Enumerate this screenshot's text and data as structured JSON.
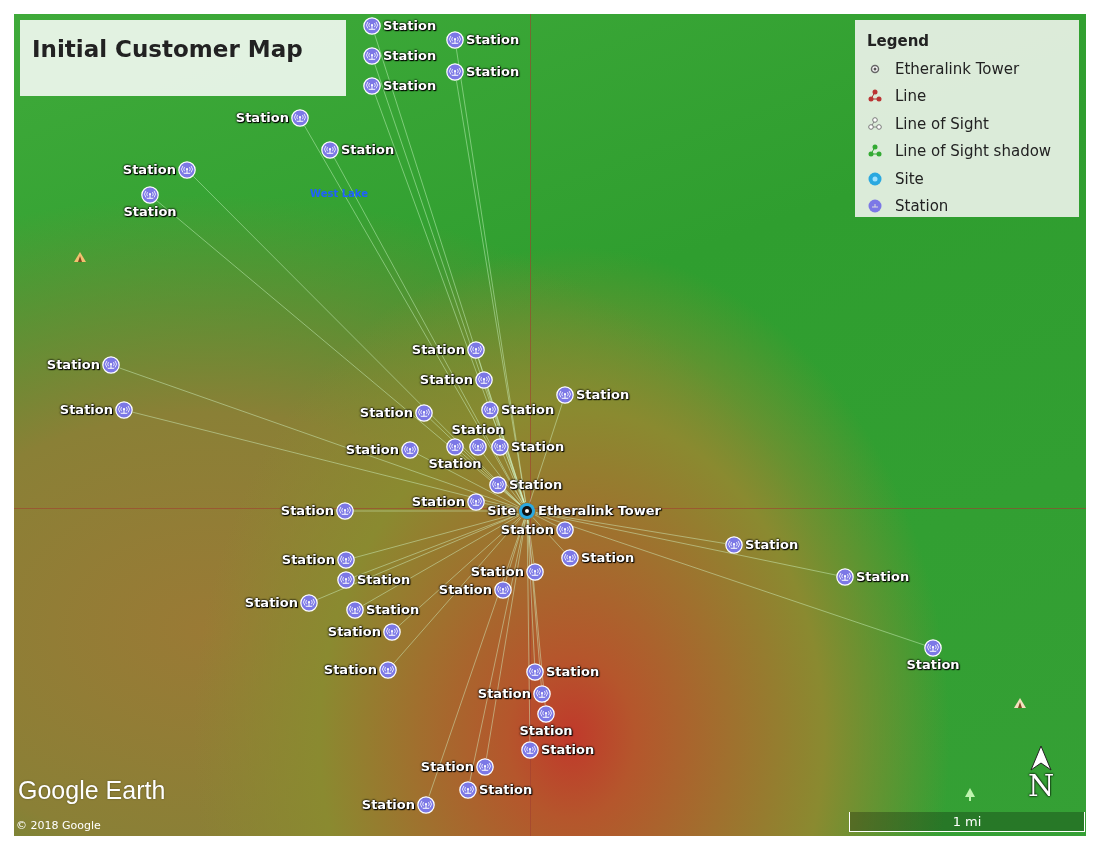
{
  "title": "Initial Customer Map",
  "legend": {
    "title": "Legend",
    "items": [
      {
        "label": "Etheralink Tower",
        "kind": "tower"
      },
      {
        "label": "Line",
        "kind": "line"
      },
      {
        "label": "Line of Sight",
        "kind": "los"
      },
      {
        "label": "Line of Sight shadow",
        "kind": "shadow"
      },
      {
        "label": "Site",
        "kind": "site"
      },
      {
        "label": "Station",
        "kind": "station"
      }
    ]
  },
  "map": {
    "place_label": "West Lake",
    "site_label": "Site",
    "tower_label": "Etheralink Tower",
    "stations": [
      {
        "label": "Station"
      },
      {
        "label": "Station"
      },
      {
        "label": "Station"
      },
      {
        "label": "Station"
      },
      {
        "label": "Station"
      },
      {
        "label": "Station"
      },
      {
        "label": "Station"
      },
      {
        "label": "Station"
      },
      {
        "label": "Station"
      },
      {
        "label": "Station"
      },
      {
        "label": "Station"
      },
      {
        "label": "Station"
      },
      {
        "label": "Station"
      },
      {
        "label": "Station"
      },
      {
        "label": "Station"
      },
      {
        "label": "Station"
      },
      {
        "label": "Station"
      },
      {
        "label": "Station"
      },
      {
        "label": "Station"
      },
      {
        "label": "Station"
      },
      {
        "label": "Station"
      },
      {
        "label": "Station"
      },
      {
        "label": "Station"
      },
      {
        "label": "Station"
      },
      {
        "label": "Station"
      },
      {
        "label": "Station"
      },
      {
        "label": "Station"
      },
      {
        "label": "Station"
      },
      {
        "label": "Station"
      },
      {
        "label": "Station"
      },
      {
        "label": "Station"
      },
      {
        "label": "Station"
      },
      {
        "label": "Station"
      },
      {
        "label": "Station"
      },
      {
        "label": "Station"
      },
      {
        "label": "Station"
      },
      {
        "label": "Station"
      },
      {
        "label": "Station"
      },
      {
        "label": "Station"
      },
      {
        "label": "Station"
      },
      {
        "label": "Station"
      },
      {
        "label": "Station"
      },
      {
        "label": "Station"
      }
    ]
  },
  "logo": "Google Earth",
  "copyright": "© 2018 Google",
  "scale": "1 mi",
  "compass": "N"
}
